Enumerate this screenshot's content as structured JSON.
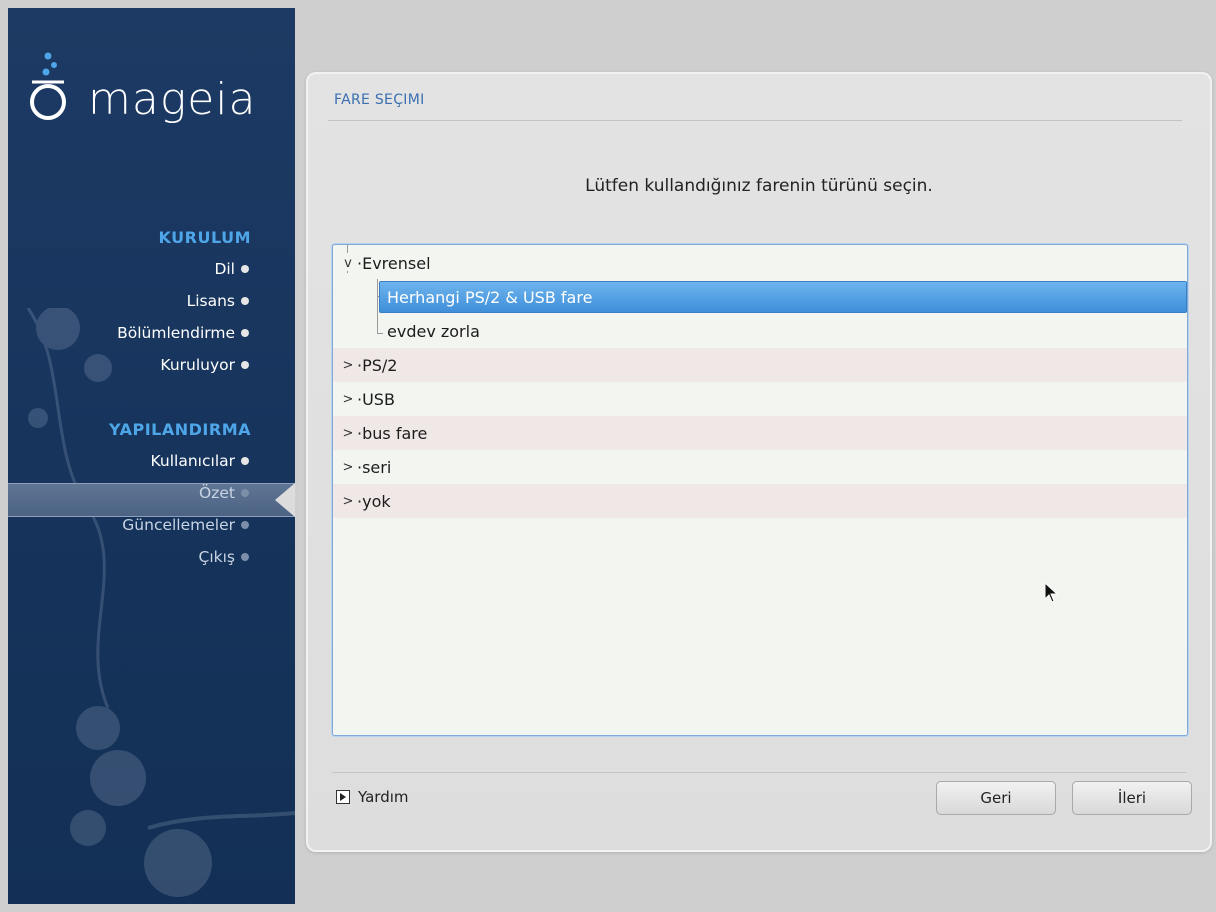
{
  "sidebar": {
    "logo_text": "mageia",
    "sections": [
      {
        "title": "KURULUM",
        "steps": [
          "Dil",
          "Lisans",
          "Bölümlendirme",
          "Kuruluyor"
        ]
      },
      {
        "title": "YAPILANDIRMA",
        "steps": [
          "Kullanıcılar",
          "Özet",
          "Güncellemeler",
          "Çıkış"
        ]
      }
    ],
    "active_step": "Özet"
  },
  "panel": {
    "title": "FARE SEÇIMI",
    "prompt": "Lütfen kullandığınız farenin türünü seçin."
  },
  "tree": {
    "items": [
      {
        "label": "Evrensel",
        "expander": "v",
        "level": 0
      },
      {
        "label": "Herhangi PS/2 & USB fare",
        "expander": "",
        "level": 1,
        "selected": true
      },
      {
        "label": "evdev zorla",
        "expander": "",
        "level": 1
      },
      {
        "label": "PS/2",
        "expander": ">",
        "level": 0
      },
      {
        "label": "USB",
        "expander": ">",
        "level": 0
      },
      {
        "label": "bus fare",
        "expander": ">",
        "level": 0
      },
      {
        "label": "seri",
        "expander": ">",
        "level": 0
      },
      {
        "label": "yok",
        "expander": ">",
        "level": 0
      }
    ]
  },
  "footer": {
    "help_label": "Yardım",
    "back_label": "Geri",
    "next_label": "İleri"
  },
  "colors": {
    "sidebar_bg": "#1c3a63",
    "section_title": "#4ea6e8",
    "panel_title": "#3a6fb0",
    "selection": "#4a9be0"
  }
}
